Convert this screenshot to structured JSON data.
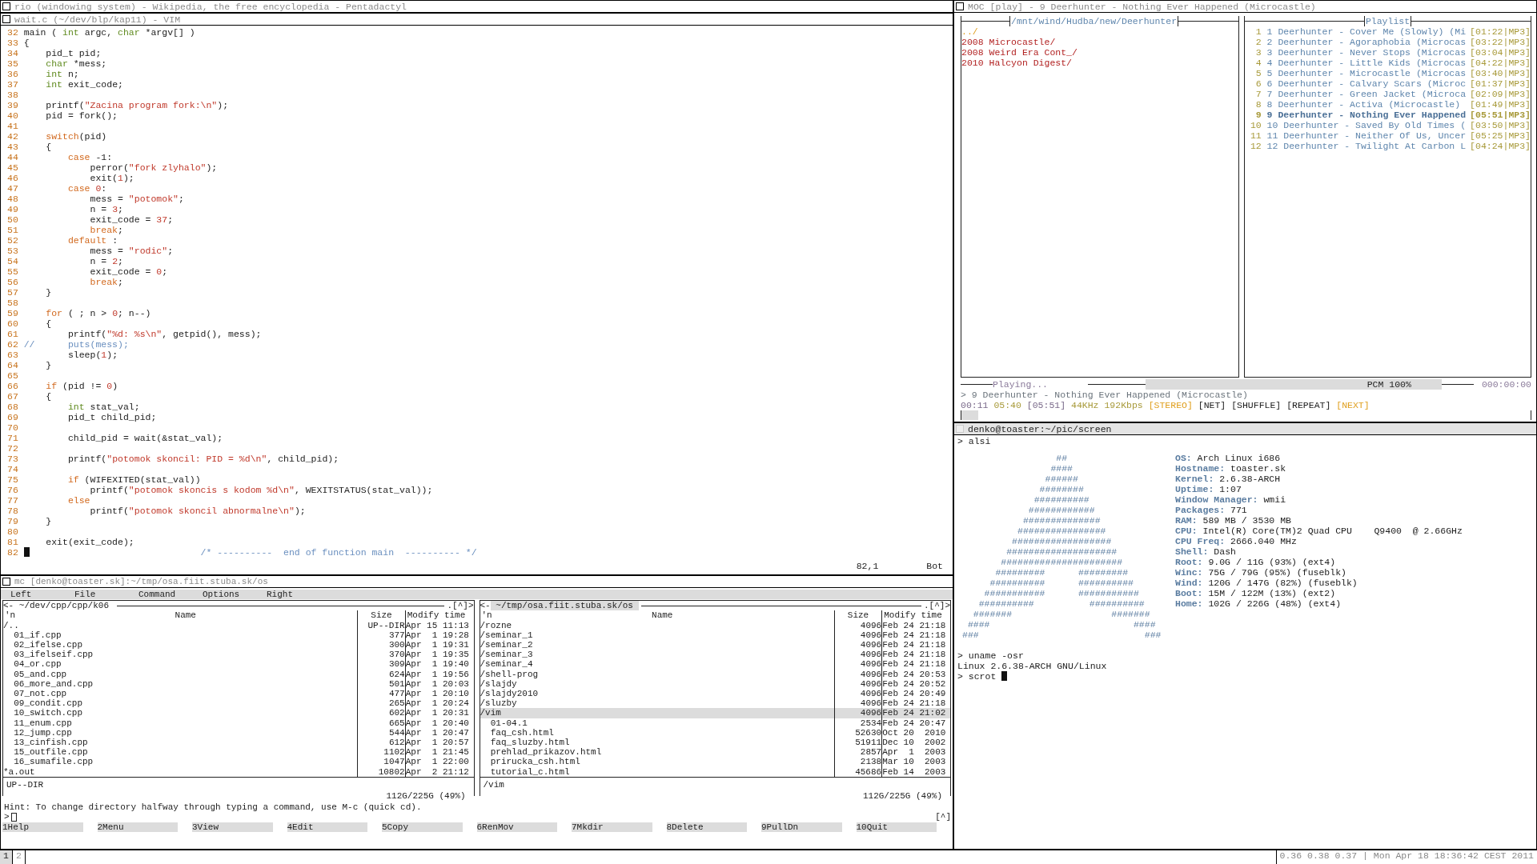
{
  "top_window": {
    "title": "rio (windowing system) - Wikipedia, the free encyclopedia - Pentadactyl"
  },
  "vim": {
    "title": "wait.c (~/dev/blp/kap11) - VIM",
    "lines": [
      {
        "number": "32",
        "parts": [
          {
            "kind": "plain",
            "text": "main ( "
          },
          {
            "kind": "type",
            "text": "int"
          },
          {
            "kind": "plain",
            "text": " argc, "
          },
          {
            "kind": "type",
            "text": "char"
          },
          {
            "kind": "plain",
            "text": " *argv[] )"
          }
        ]
      },
      {
        "number": "33",
        "parts": [
          {
            "kind": "plain",
            "text": "{"
          }
        ]
      },
      {
        "number": "34",
        "parts": [
          {
            "kind": "plain",
            "text": "    pid_t pid;"
          }
        ]
      },
      {
        "number": "35",
        "parts": [
          {
            "kind": "type",
            "text": "    char"
          },
          {
            "kind": "plain",
            "text": " *mess;"
          }
        ]
      },
      {
        "number": "36",
        "parts": [
          {
            "kind": "type",
            "text": "    int"
          },
          {
            "kind": "plain",
            "text": " n;"
          }
        ]
      },
      {
        "number": "37",
        "parts": [
          {
            "kind": "type",
            "text": "    int"
          },
          {
            "kind": "plain",
            "text": " exit_code;"
          }
        ]
      },
      {
        "number": "38"
      },
      {
        "number": "39",
        "parts": [
          {
            "kind": "plain",
            "text": "    printf("
          },
          {
            "kind": "string",
            "text": "\"Zacina program fork:\\n\""
          },
          {
            "kind": "plain",
            "text": ");"
          }
        ]
      },
      {
        "number": "40",
        "parts": [
          {
            "kind": "plain",
            "text": "    pid = fork();"
          }
        ]
      },
      {
        "number": "41"
      },
      {
        "number": "42",
        "parts": [
          {
            "kind": "keyword",
            "text": "    switch"
          },
          {
            "kind": "plain",
            "text": "(pid)"
          }
        ]
      },
      {
        "number": "43",
        "parts": [
          {
            "kind": "plain",
            "text": "    {"
          }
        ]
      },
      {
        "number": "44",
        "parts": [
          {
            "kind": "keyword",
            "text": "        case"
          },
          {
            "kind": "plain",
            "text": " -1:"
          }
        ]
      },
      {
        "number": "45",
        "parts": [
          {
            "kind": "plain",
            "text": "            perror("
          },
          {
            "kind": "string",
            "text": "\"fork zlyhalo\""
          },
          {
            "kind": "plain",
            "text": ");"
          }
        ]
      },
      {
        "number": "46",
        "parts": [
          {
            "kind": "plain",
            "text": "            exit("
          },
          {
            "kind": "number",
            "text": "1"
          },
          {
            "kind": "plain",
            "text": ");"
          }
        ]
      },
      {
        "number": "47",
        "parts": [
          {
            "kind": "keyword",
            "text": "        case"
          },
          {
            "kind": "number",
            "text": " 0"
          },
          {
            "kind": "plain",
            "text": ":"
          }
        ]
      },
      {
        "number": "48",
        "parts": [
          {
            "kind": "plain",
            "text": "            mess = "
          },
          {
            "kind": "string",
            "text": "\"potomok\""
          },
          {
            "kind": "plain",
            "text": ";"
          }
        ]
      },
      {
        "number": "49",
        "parts": [
          {
            "kind": "plain",
            "text": "            n = "
          },
          {
            "kind": "number",
            "text": "3"
          },
          {
            "kind": "plain",
            "text": ";"
          }
        ]
      },
      {
        "number": "50",
        "parts": [
          {
            "kind": "plain",
            "text": "            exit_code = "
          },
          {
            "kind": "number",
            "text": "37"
          },
          {
            "kind": "plain",
            "text": ";"
          }
        ]
      },
      {
        "number": "51",
        "parts": [
          {
            "kind": "keyword",
            "text": "            break"
          },
          {
            "kind": "plain",
            "text": ";"
          }
        ]
      },
      {
        "number": "52",
        "parts": [
          {
            "kind": "keyword",
            "text": "        default"
          },
          {
            "kind": "plain",
            "text": " :"
          }
        ]
      },
      {
        "number": "53",
        "parts": [
          {
            "kind": "plain",
            "text": "            mess = "
          },
          {
            "kind": "string",
            "text": "\"rodic\""
          },
          {
            "kind": "plain",
            "text": ";"
          }
        ]
      },
      {
        "number": "54",
        "parts": [
          {
            "kind": "plain",
            "text": "            n = "
          },
          {
            "kind": "number",
            "text": "2"
          },
          {
            "kind": "plain",
            "text": ";"
          }
        ]
      },
      {
        "number": "55",
        "parts": [
          {
            "kind": "plain",
            "text": "            exit_code = "
          },
          {
            "kind": "number",
            "text": "0"
          },
          {
            "kind": "plain",
            "text": ";"
          }
        ]
      },
      {
        "number": "56",
        "parts": [
          {
            "kind": "keyword",
            "text": "            break"
          },
          {
            "kind": "plain",
            "text": ";"
          }
        ]
      },
      {
        "number": "57",
        "parts": [
          {
            "kind": "plain",
            "text": "    }"
          }
        ]
      },
      {
        "number": "58"
      },
      {
        "number": "59",
        "parts": [
          {
            "kind": "keyword",
            "text": "    for"
          },
          {
            "kind": "plain",
            "text": " ( ; n > "
          },
          {
            "kind": "number",
            "text": "0"
          },
          {
            "kind": "plain",
            "text": "; n--)"
          }
        ]
      },
      {
        "number": "60",
        "parts": [
          {
            "kind": "plain",
            "text": "    {"
          }
        ]
      },
      {
        "number": "61",
        "parts": [
          {
            "kind": "plain",
            "text": "        printf("
          },
          {
            "kind": "string",
            "text": "\"%d: %s\\n\""
          },
          {
            "kind": "plain",
            "text": ", getpid(), mess);"
          }
        ]
      },
      {
        "number": "62",
        "parts": [
          {
            "kind": "comment",
            "text": "//      puts(mess);"
          }
        ]
      },
      {
        "number": "63",
        "parts": [
          {
            "kind": "plain",
            "text": "        sleep("
          },
          {
            "kind": "number",
            "text": "1"
          },
          {
            "kind": "plain",
            "text": ");"
          }
        ]
      },
      {
        "number": "64",
        "parts": [
          {
            "kind": "plain",
            "text": "    }"
          }
        ]
      },
      {
        "number": "65"
      },
      {
        "number": "66",
        "parts": [
          {
            "kind": "keyword",
            "text": "    if"
          },
          {
            "kind": "plain",
            "text": " (pid != "
          },
          {
            "kind": "number",
            "text": "0"
          },
          {
            "kind": "plain",
            "text": ")"
          }
        ]
      },
      {
        "number": "67",
        "parts": [
          {
            "kind": "plain",
            "text": "    {"
          }
        ]
      },
      {
        "number": "68",
        "parts": [
          {
            "kind": "type",
            "text": "        int"
          },
          {
            "kind": "plain",
            "text": " stat_val;"
          }
        ]
      },
      {
        "number": "69",
        "parts": [
          {
            "kind": "plain",
            "text": "        pid_t child_pid;"
          }
        ]
      },
      {
        "number": "70"
      },
      {
        "number": "71",
        "parts": [
          {
            "kind": "plain",
            "text": "        child_pid = wait(&stat_val);"
          }
        ]
      },
      {
        "number": "72"
      },
      {
        "number": "73",
        "parts": [
          {
            "kind": "plain",
            "text": "        printf("
          },
          {
            "kind": "string",
            "text": "\"potomok skoncil: PID = %d\\n\""
          },
          {
            "kind": "plain",
            "text": ", child_pid);"
          }
        ]
      },
      {
        "number": "74"
      },
      {
        "number": "75",
        "parts": [
          {
            "kind": "keyword",
            "text": "        if"
          },
          {
            "kind": "plain",
            "text": " (WIFEXITED(stat_val))"
          }
        ]
      },
      {
        "number": "76",
        "parts": [
          {
            "kind": "plain",
            "text": "            printf("
          },
          {
            "kind": "string",
            "text": "\"potomok skoncis s kodom %d\\n\""
          },
          {
            "kind": "plain",
            "text": ", WEXITSTATUS(stat_val));"
          }
        ]
      },
      {
        "number": "77",
        "parts": [
          {
            "kind": "keyword",
            "text": "        else"
          }
        ]
      },
      {
        "number": "78",
        "parts": [
          {
            "kind": "plain",
            "text": "            printf("
          },
          {
            "kind": "string",
            "text": "\"potomok skoncil abnormalne\\n\""
          },
          {
            "kind": "plain",
            "text": ");"
          }
        ]
      },
      {
        "number": "79",
        "parts": [
          {
            "kind": "plain",
            "text": "    }"
          }
        ]
      },
      {
        "number": "80"
      },
      {
        "number": "81",
        "parts": [
          {
            "kind": "plain",
            "text": "    exit(exit_code);"
          }
        ]
      },
      {
        "number": "82",
        "cursor": true,
        "parts": [
          {
            "kind": "comment",
            "text": "                               /* ----------  end of function main  ---------- */"
          }
        ]
      }
    ],
    "ruler": "82,1",
    "position": "Bot"
  },
  "moc": {
    "title": "MOC [play] - 9 Deerhunter - Nothing Ever Happened (Microcastle)",
    "browser": {
      "path": "/mnt/wind/Hudba/new/Deerhunter",
      "items": [
        {
          "kind": "parent",
          "name": "../"
        },
        {
          "kind": "dir",
          "name": "2008 Microcastle/"
        },
        {
          "kind": "dir",
          "name": "2008 Weird Era Cont_/"
        },
        {
          "kind": "dir",
          "name": "2010 Halcyon Digest/"
        }
      ]
    },
    "playlist": {
      "title": "Playlist",
      "items": [
        {
          "number": "1",
          "title": "1 Deerhunter - Cover Me (Slowly) (Mi",
          "info": "[01:22|MP3]",
          "selected": false
        },
        {
          "number": "2",
          "title": "2 Deerhunter - Agoraphobia (Microcas",
          "info": "[03:22|MP3]",
          "selected": false
        },
        {
          "number": "3",
          "title": "3 Deerhunter - Never Stops (Microcas",
          "info": "[03:04|MP3]",
          "selected": false
        },
        {
          "number": "4",
          "title": "4 Deerhunter - Little Kids (Microcas",
          "info": "[04:22|MP3]",
          "selected": false
        },
        {
          "number": "5",
          "title": "5 Deerhunter - Microcastle (Microcas",
          "info": "[03:40|MP3]",
          "selected": false
        },
        {
          "number": "6",
          "title": "6 Deerhunter - Calvary Scars (Microc",
          "info": "[01:37|MP3]",
          "selected": false
        },
        {
          "number": "7",
          "title": "7 Deerhunter - Green Jacket (Microca",
          "info": "[02:09|MP3]",
          "selected": false
        },
        {
          "number": "8",
          "title": "8 Deerhunter - Activa (Microcastle)",
          "info": "[01:49|MP3]",
          "selected": false
        },
        {
          "number": "9",
          "title": "9 Deerhunter - Nothing Ever Happened",
          "info": "[05:51|MP3]",
          "selected": true
        },
        {
          "number": "10",
          "title": "10 Deerhunter - Saved By Old Times (",
          "info": "[03:50|MP3]",
          "selected": false
        },
        {
          "number": "11",
          "title": "11 Deerhunter - Neither Of Us, Uncer",
          "info": "[05:25|MP3]",
          "selected": false
        },
        {
          "number": "12",
          "title": "12 Deerhunter - Twilight At Carbon L",
          "info": "[04:24|MP3]",
          "selected": false
        }
      ]
    },
    "status": "Playing...",
    "mixer": "PCM 100%",
    "counter": "000:00:00",
    "now_playing": "> 9 Deerhunter - Nothing Ever Happened (Microcastle)",
    "info": [
      {
        "kind": "time",
        "text": "00:11"
      },
      {
        "kind": "stat",
        "text": "05:40"
      },
      {
        "kind": "time",
        "text": "[05:51]"
      },
      {
        "kind": "stat",
        "text": "44KHz"
      },
      {
        "kind": "stat",
        "text": "192Kbps"
      }
    ],
    "flags": [
      {
        "text": "[STEREO]",
        "on": true
      },
      {
        "text": "[NET]",
        "on": false
      },
      {
        "text": "[SHUFFLE]",
        "on": false
      },
      {
        "text": "[REPEAT]",
        "on": false
      },
      {
        "text": "[NEXT]",
        "on": true
      }
    ],
    "progress": {
      "level": 0.03
    }
  },
  "terminal": {
    "title": "denko@toaster:~/pic/screen",
    "before": [
      {
        "text": "> alsi"
      }
    ],
    "art": [
      "                 ##",
      "                ####",
      "               ######",
      "              ########",
      "             ##########",
      "            ############",
      "           ##############",
      "          ################",
      "         ##################",
      "        ####################",
      "       ######################",
      "      #########      #########",
      "     ##########      ##########",
      "    ###########      ###########",
      "   ##########          ##########",
      "  #######                  #######",
      " ####                          ####",
      "###                              ###"
    ],
    "info": [
      {
        "label": "OS:",
        "value": "Arch Linux i686"
      },
      {
        "label": "Hostname:",
        "value": "toaster.sk"
      },
      {
        "label": "Kernel:",
        "value": "2.6.38-ARCH"
      },
      {
        "label": "Uptime:",
        "value": "1:07"
      },
      {
        "label": "Window Manager:",
        "value": "wmii"
      },
      {
        "label": "Packages:",
        "value": "771"
      },
      {
        "label": "RAM:",
        "value": "589 MB / 3530 MB"
      },
      {
        "label": "CPU:",
        "value": "Intel(R) Core(TM)2 Quad CPU    Q9400  @ 2.66GHz"
      },
      {
        "label": "CPU Freq:",
        "value": "2666.040 MHz"
      },
      {
        "label": "Shell:",
        "value": "Dash"
      },
      {
        "label": "Root:",
        "value": "9.0G / 11G (93%) (ext4)"
      },
      {
        "label": "Winc:",
        "value": "75G / 79G (95%) (fuseblk)"
      },
      {
        "label": "Wind:",
        "value": "120G / 147G (82%) (fuseblk)"
      },
      {
        "label": "Boot:",
        "value": "15M / 122M (13%) (ext2)"
      },
      {
        "label": "Home:",
        "value": "102G / 226G (48%) (ext4)"
      }
    ],
    "after": [
      {
        "text": "> uname -osr"
      },
      {
        "text": "Linux 2.6.38-ARCH GNU/Linux"
      },
      {
        "text": "> scrot",
        "cursor": true
      }
    ]
  },
  "mc": {
    "title": "mc [denko@toaster.sk]:~/tmp/osa.fiit.stuba.sk/os",
    "menu": [
      "Left",
      "File",
      "Command",
      "Options",
      "Right"
    ],
    "panels": [
      {
        "selected": false,
        "back": "<-",
        "path": "~/dev/cpp/cpp/k06",
        "nav": ".[^]>",
        "columns": [
          "'n",
          "Name",
          "Size",
          "Modify time"
        ],
        "rows": [
          {
            "kind": "dir",
            "name": "/..",
            "size": "UP--DIR",
            "modified": "Apr 15 11:13",
            "selected": false
          },
          {
            "kind": "file",
            "name": "01_if.cpp",
            "size": "377",
            "modified": "Apr  1 19:28",
            "selected": false
          },
          {
            "kind": "file",
            "name": "02_ifelse.cpp",
            "size": "300",
            "modified": "Apr  1 19:31",
            "selected": false
          },
          {
            "kind": "file",
            "name": "03_ifelseif.cpp",
            "size": "370",
            "modified": "Apr  1 19:35",
            "selected": false
          },
          {
            "kind": "file",
            "name": "04_or.cpp",
            "size": "309",
            "modified": "Apr  1 19:40",
            "selected": false
          },
          {
            "kind": "file",
            "name": "05_and.cpp",
            "size": "624",
            "modified": "Apr  1 19:56",
            "selected": false
          },
          {
            "kind": "file",
            "name": "06_more_and.cpp",
            "size": "501",
            "modified": "Apr  1 20:03",
            "selected": false
          },
          {
            "kind": "file",
            "name": "07_not.cpp",
            "size": "477",
            "modified": "Apr  1 20:10",
            "selected": false
          },
          {
            "kind": "file",
            "name": "09_condit.cpp",
            "size": "265",
            "modified": "Apr  1 20:24",
            "selected": false
          },
          {
            "kind": "file",
            "name": "10_switch.cpp",
            "size": "602",
            "modified": "Apr  1 20:31",
            "selected": false
          },
          {
            "kind": "file",
            "name": "11_enum.cpp",
            "size": "665",
            "modified": "Apr  1 20:40",
            "selected": false
          },
          {
            "kind": "file",
            "name": "12_jump.cpp",
            "size": "544",
            "modified": "Apr  1 20:47",
            "selected": false
          },
          {
            "kind": "file",
            "name": "13_cinfish.cpp",
            "size": "612",
            "modified": "Apr  1 20:57",
            "selected": false
          },
          {
            "kind": "file",
            "name": "15_outfile.cpp",
            "size": "1102",
            "modified": "Apr  1 21:45",
            "selected": false
          },
          {
            "kind": "file",
            "name": "16_sumafile.cpp",
            "size": "1047",
            "modified": "Apr  1 22:00",
            "selected": false
          },
          {
            "kind": "dir",
            "name": "*a.out",
            "size": "10802",
            "modified": "Apr  2 21:12",
            "selected": false
          }
        ],
        "info": "UP--DIR",
        "disk": "112G/225G (49%)"
      },
      {
        "selected": true,
        "back": "<-",
        "path": "~/tmp/osa.fiit.stuba.sk/os",
        "nav": ".[^]>",
        "columns": [
          "'n",
          "Name",
          "Size",
          "Modify time"
        ],
        "rows": [
          {
            "kind": "dir",
            "name": "/rozne",
            "size": "4096",
            "modified": "Feb 24 21:18",
            "selected": false
          },
          {
            "kind": "dir",
            "name": "/seminar_1",
            "size": "4096",
            "modified": "Feb 24 21:18",
            "selected": false
          },
          {
            "kind": "dir",
            "name": "/seminar_2",
            "size": "4096",
            "modified": "Feb 24 21:18",
            "selected": false
          },
          {
            "kind": "dir",
            "name": "/seminar_3",
            "size": "4096",
            "modified": "Feb 24 21:18",
            "selected": false
          },
          {
            "kind": "dir",
            "name": "/seminar_4",
            "size": "4096",
            "modified": "Feb 24 21:18",
            "selected": false
          },
          {
            "kind": "dir",
            "name": "/shell-prog",
            "size": "4096",
            "modified": "Feb 24 20:53",
            "selected": false
          },
          {
            "kind": "dir",
            "name": "/slajdy",
            "size": "4096",
            "modified": "Feb 24 20:52",
            "selected": false
          },
          {
            "kind": "dir",
            "name": "/slajdy2010",
            "size": "4096",
            "modified": "Feb 24 20:49",
            "selected": false
          },
          {
            "kind": "dir",
            "name": "/sluzby",
            "size": "4096",
            "modified": "Feb 24 21:18",
            "selected": false
          },
          {
            "kind": "dir",
            "name": "/vim",
            "size": "4096",
            "modified": "Feb 24 21:02",
            "selected": true
          },
          {
            "kind": "file",
            "name": "01-04.1",
            "size": "2534",
            "modified": "Feb 24 20:47",
            "selected": false
          },
          {
            "kind": "file",
            "name": "faq_csh.html",
            "size": "52630",
            "modified": "Oct 20  2010",
            "selected": false
          },
          {
            "kind": "file",
            "name": "faq_sluzby.html",
            "size": "51911",
            "modified": "Dec 10  2002",
            "selected": false
          },
          {
            "kind": "file",
            "name": "prehlad_prikazov.html",
            "size": "2857",
            "modified": "Apr  1  2003",
            "selected": false
          },
          {
            "kind": "file",
            "name": "prirucka_csh.html",
            "size": "2138",
            "modified": "Mar 10  2003",
            "selected": false
          },
          {
            "kind": "file",
            "name": "tutorial_c.html",
            "size": "45686",
            "modified": "Feb 14  2003",
            "selected": false
          }
        ],
        "info": "/vim",
        "disk": "112G/225G (49%)"
      }
    ],
    "hint": "Hint: To change directory halfway through typing a command, use M-c (quick cd).",
    "prompt": ">",
    "history": "[^]",
    "keys": [
      {
        "number": "1",
        "label": "Help"
      },
      {
        "number": "2",
        "label": "Menu"
      },
      {
        "number": "3",
        "label": "View"
      },
      {
        "number": "4",
        "label": "Edit"
      },
      {
        "number": "5",
        "label": "Copy"
      },
      {
        "number": "6",
        "label": "RenMov"
      },
      {
        "number": "7",
        "label": "Mkdir"
      },
      {
        "number": "8",
        "label": "Delete"
      },
      {
        "number": "9",
        "label": "PullDn"
      },
      {
        "number": "10",
        "label": "Quit"
      }
    ]
  },
  "bar": {
    "tags": [
      {
        "label": "1",
        "selected": true
      },
      {
        "label": "2",
        "selected": false
      }
    ],
    "status": "0.36 0.38 0.37 | Mon Apr 18 18:36:42 CEST 2011"
  }
}
